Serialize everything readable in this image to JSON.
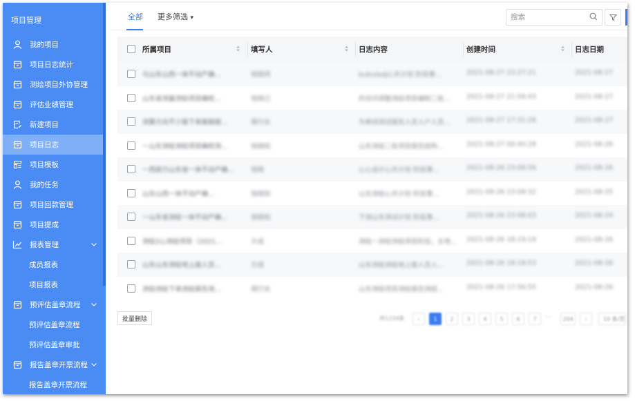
{
  "sidebar": {
    "title": "项目管理",
    "items": [
      {
        "label": "我的项目",
        "icon": "user-icon"
      },
      {
        "label": "项目日志统计",
        "icon": "box-icon"
      },
      {
        "label": "测绘项目外协管理",
        "icon": "box-icon"
      },
      {
        "label": "评估业绩管理",
        "icon": "box-icon"
      },
      {
        "label": "新建项目",
        "icon": "file-edit-icon"
      },
      {
        "label": "项目日志",
        "icon": "box-icon",
        "active": true
      },
      {
        "label": "项目模板",
        "icon": "template-icon"
      },
      {
        "label": "我的任务",
        "icon": "user-icon"
      },
      {
        "label": "项目回款管理",
        "icon": "box-icon"
      },
      {
        "label": "项目提成",
        "icon": "box-icon"
      },
      {
        "label": "报表管理",
        "icon": "chart-icon",
        "expandable": true
      },
      {
        "label": "成员报表",
        "sub": true
      },
      {
        "label": "项目报表",
        "sub": true
      },
      {
        "label": "预评估盖章流程",
        "icon": "box-icon",
        "expandable": true
      },
      {
        "label": "预评估盖章流程",
        "sub": true
      },
      {
        "label": "预评估盖章审批",
        "sub": true
      },
      {
        "label": "报告盖章开票流程",
        "icon": "box-icon",
        "expandable": true
      },
      {
        "label": "报告盖章开票流程",
        "sub": true
      }
    ]
  },
  "tabs": {
    "all": "全部",
    "more": "更多筛选",
    "more_arrow": "▾"
  },
  "search": {
    "placeholder": "搜索"
  },
  "table": {
    "columns": [
      "所属项目",
      "填写人",
      "日志内容",
      "创建时间",
      "日志日期"
    ],
    "rows": [
      [
        "与山东山西一体不动产确...",
        "钱晓珂",
        "bubuladJ心天计划   阶段事...",
        "2021-08-27 23:27:21",
        "2021-08-27"
      ],
      [
        "山东省测量测绘项目确权...",
        "钱晓己",
        "的访问调整测绘项目编制二批...",
        "2021-08-27 21:56:43",
        "2021-08-27"
      ],
      [
        "测算方向不少报下来做做报...",
        "周行长",
        "为单间测试报告人员入户人员...",
        "2021-08-27 17:31:26",
        "2021-08-27"
      ],
      [
        "一山东测绘测绘项目确权测...",
        "钱晓知",
        "山东测绘二批项目报告结构...",
        "2021-08-27 00:40:28",
        "2021-08-26"
      ],
      [
        "一西部力山东省一体不动产确...",
        "钱晓",
        "心心设计心天计划   阶段事...",
        "2021-08-26 23:08:56",
        "2021-08-26"
      ],
      [
        "山东山西一体不动产确...",
        "钱晓知",
        "山东测绘心天计划   阶段事...",
        "2021-08-26 23:08:32",
        "2021-08-25"
      ],
      [
        "一山东省测绘一体不动产确...",
        "钱晓知",
        "下测山东测试计划   阶段事...",
        "2021-08-26 23:08:03",
        "2021-08-24"
      ],
      [
        "测绘2心测绘项目（2021...",
        "方成",
        "测绘一测绘测绘项目阶段，主地...",
        "2021-08-26 18:19:19",
        "2021-08-26"
      ],
      [
        "山东山东测绘地上面人员...",
        "方成",
        "山东测绘测绘地上面人员人...",
        "2021-08-26 18:18:53",
        "2021-08-26"
      ],
      [
        "测绘测绘下来测绘报告测...",
        "周行长",
        "山东测绘项目测绘报告测结...",
        "2021-08-26 17:56:55",
        "2021-08-26"
      ]
    ]
  },
  "footer": {
    "batch_delete": "批量删除",
    "total": "共1234条",
    "prev": "‹",
    "pages": [
      "1",
      "2",
      "3",
      "4",
      "5",
      "6",
      "7"
    ],
    "ellipsis": "···",
    "last_page": "204",
    "next": "›",
    "page_size": "10 条/页"
  }
}
